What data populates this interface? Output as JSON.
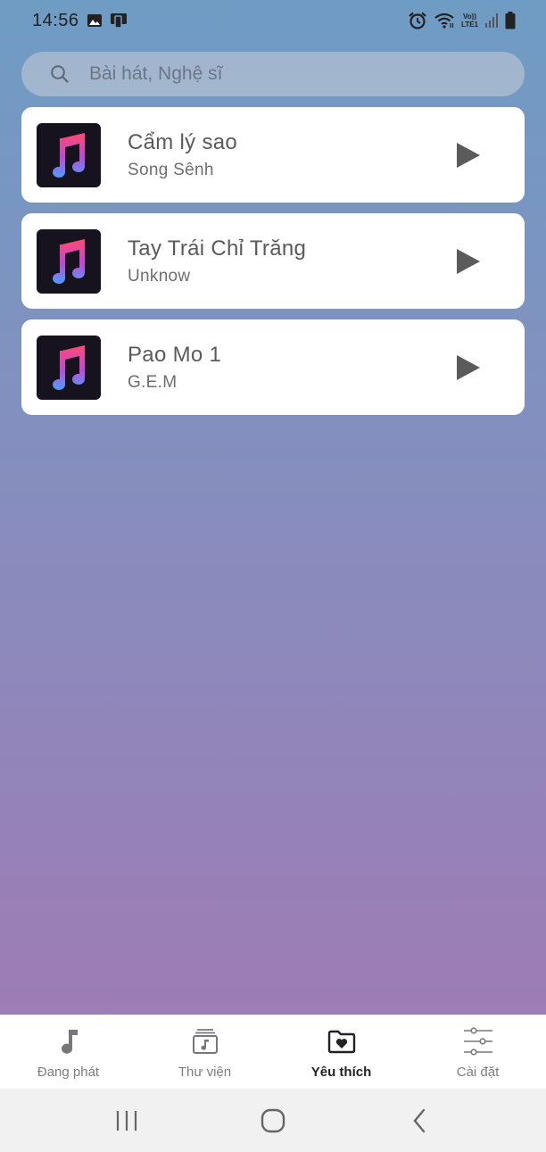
{
  "status_bar": {
    "time": "14:56",
    "left_icons": [
      "gallery-icon",
      "screen-mirror-icon"
    ],
    "right_icons": [
      "alarm-icon",
      "wifi-icon",
      "volte-icon",
      "signal-icon",
      "battery-icon"
    ],
    "volte_label_top": "Vo))",
    "volte_label_bottom": "LTE1"
  },
  "search": {
    "placeholder": "Bài hát, Nghệ sĩ",
    "icon": "search-icon"
  },
  "songs": [
    {
      "title": "Cẩm lý sao",
      "artist": "Song Sênh",
      "art_icon": "music-note-icon",
      "action_icon": "play-icon"
    },
    {
      "title": "Tay Trái Chỉ Trăng",
      "artist": "Unknow",
      "art_icon": "music-note-icon",
      "action_icon": "play-icon"
    },
    {
      "title": "Pao Mo 1",
      "artist": "G.E.M",
      "art_icon": "music-note-icon",
      "action_icon": "play-icon"
    }
  ],
  "bottom_nav": {
    "items": [
      {
        "label": "Đang phát",
        "icon": "music-note-icon",
        "active": false
      },
      {
        "label": "Thư viện",
        "icon": "library-icon",
        "active": false
      },
      {
        "label": "Yêu thích",
        "icon": "favorite-folder-icon",
        "active": true
      },
      {
        "label": "Cài đặt",
        "icon": "settings-sliders-icon",
        "active": false
      }
    ]
  },
  "system_nav": [
    "recent-apps-icon",
    "home-icon",
    "back-icon"
  ],
  "colors": {
    "gradient_top": "#6f9cc4",
    "gradient_bottom": "#a477b2",
    "card_bg": "#ffffff",
    "active_nav": "#222222",
    "inactive_nav": "#7d7d7d"
  }
}
